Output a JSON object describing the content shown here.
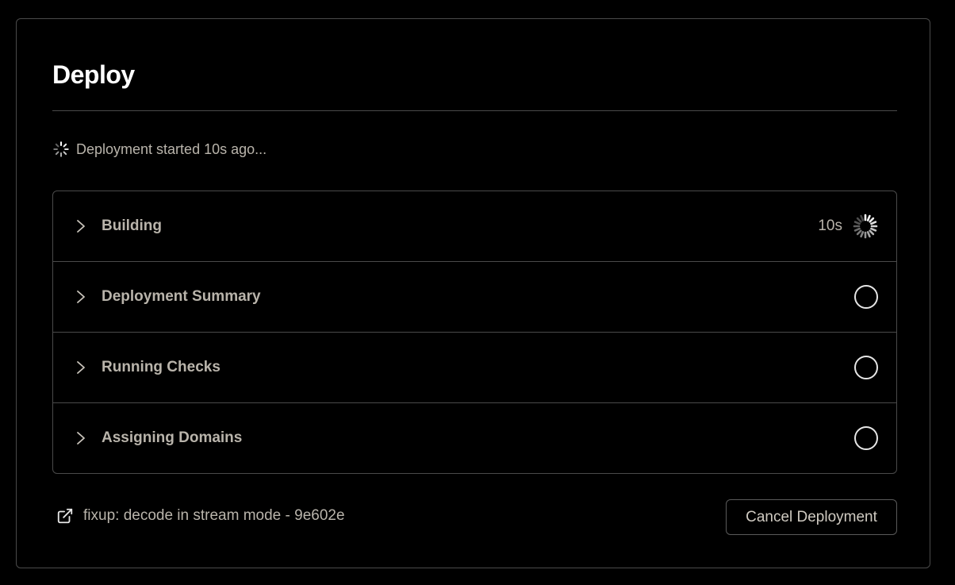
{
  "dialog": {
    "title": "Deploy",
    "status_text": "Deployment started 10s ago...",
    "steps": [
      {
        "label": "Building",
        "duration": "10s",
        "state": "in-progress",
        "icon": "spinner-icon"
      },
      {
        "label": "Deployment Summary",
        "state": "pending",
        "icon": "circle-icon"
      },
      {
        "label": "Running Checks",
        "state": "pending",
        "icon": "circle-icon"
      },
      {
        "label": "Assigning Domains",
        "state": "pending",
        "icon": "circle-icon"
      }
    ],
    "commit_link": {
      "text": "fixup: decode in stream mode - 9e602e",
      "icon": "external-link-icon"
    },
    "cancel_label": "Cancel Deployment"
  },
  "colors": {
    "background": "#000000",
    "border": "#4a4a4a",
    "title": "#ffffff",
    "muted_text": "#b9b4ab"
  }
}
